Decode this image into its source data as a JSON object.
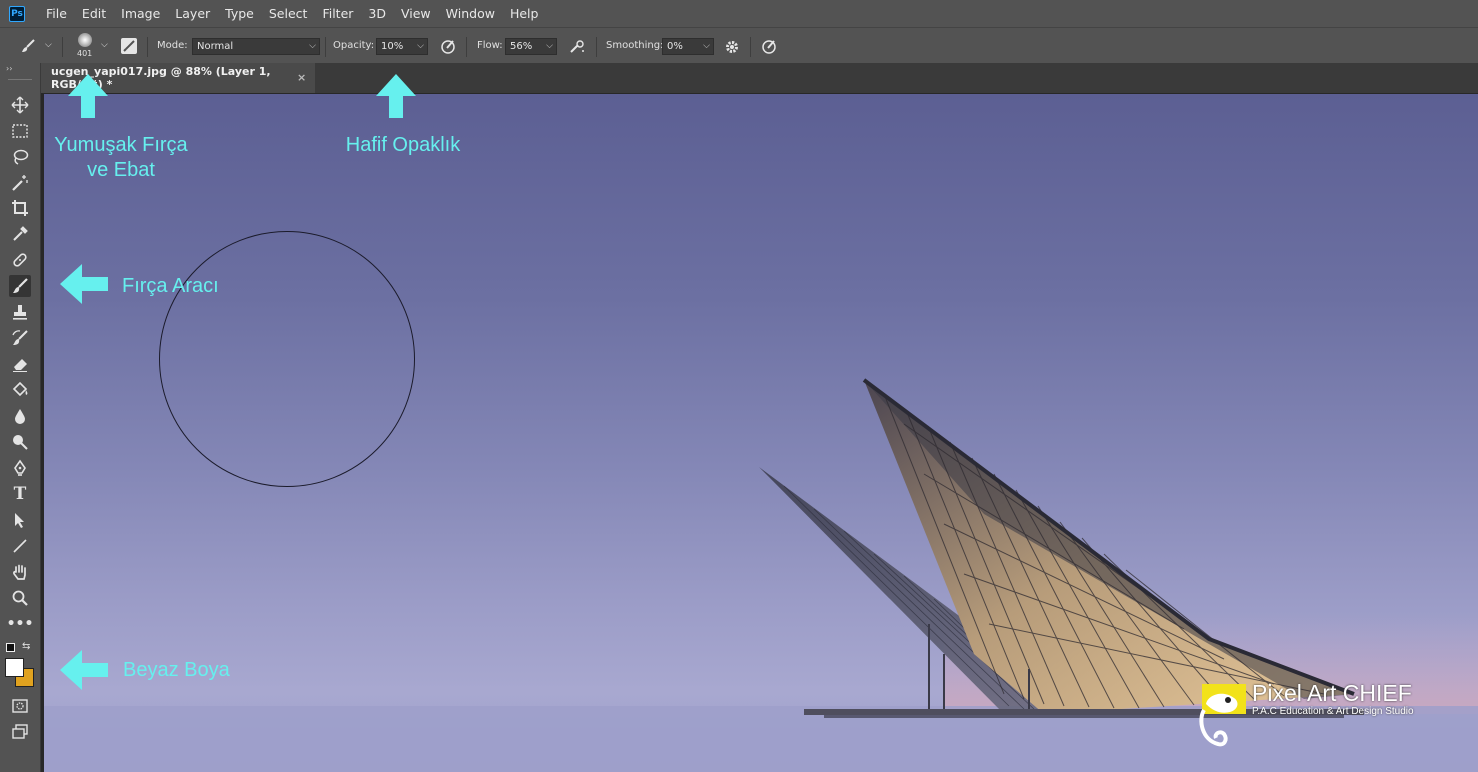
{
  "app": {
    "logo_text": "Ps"
  },
  "menu": [
    "File",
    "Edit",
    "Image",
    "Layer",
    "Type",
    "Select",
    "Filter",
    "3D",
    "View",
    "Window",
    "Help"
  ],
  "options": {
    "brush_size": "401",
    "mode_label": "Mode:",
    "mode_value": "Normal",
    "opacity_label": "Opacity:",
    "opacity_value": "10%",
    "flow_label": "Flow:",
    "flow_value": "56%",
    "smoothing_label": "Smoothing:",
    "smoothing_value": "0%"
  },
  "document": {
    "tab_title": "ucgen_yapi017.jpg @ 88% (Layer 1, RGB/8#) *",
    "close_glyph": "×"
  },
  "annotations": {
    "soft_brush": [
      "Yumuşak Fırça",
      "ve Ebat"
    ],
    "light_opacity": "Hafif Opaklık",
    "brush_tool": "Fırça Aracı",
    "white_paint": "Beyaz Boya"
  },
  "watermark": {
    "title": "Pixel Art CHIEF",
    "subtitle": "P.A.C Education & Art Design Studio"
  },
  "colors": {
    "annotation": "#66f0ee",
    "foreground": "#ffffff",
    "background": "#e0a21f"
  }
}
